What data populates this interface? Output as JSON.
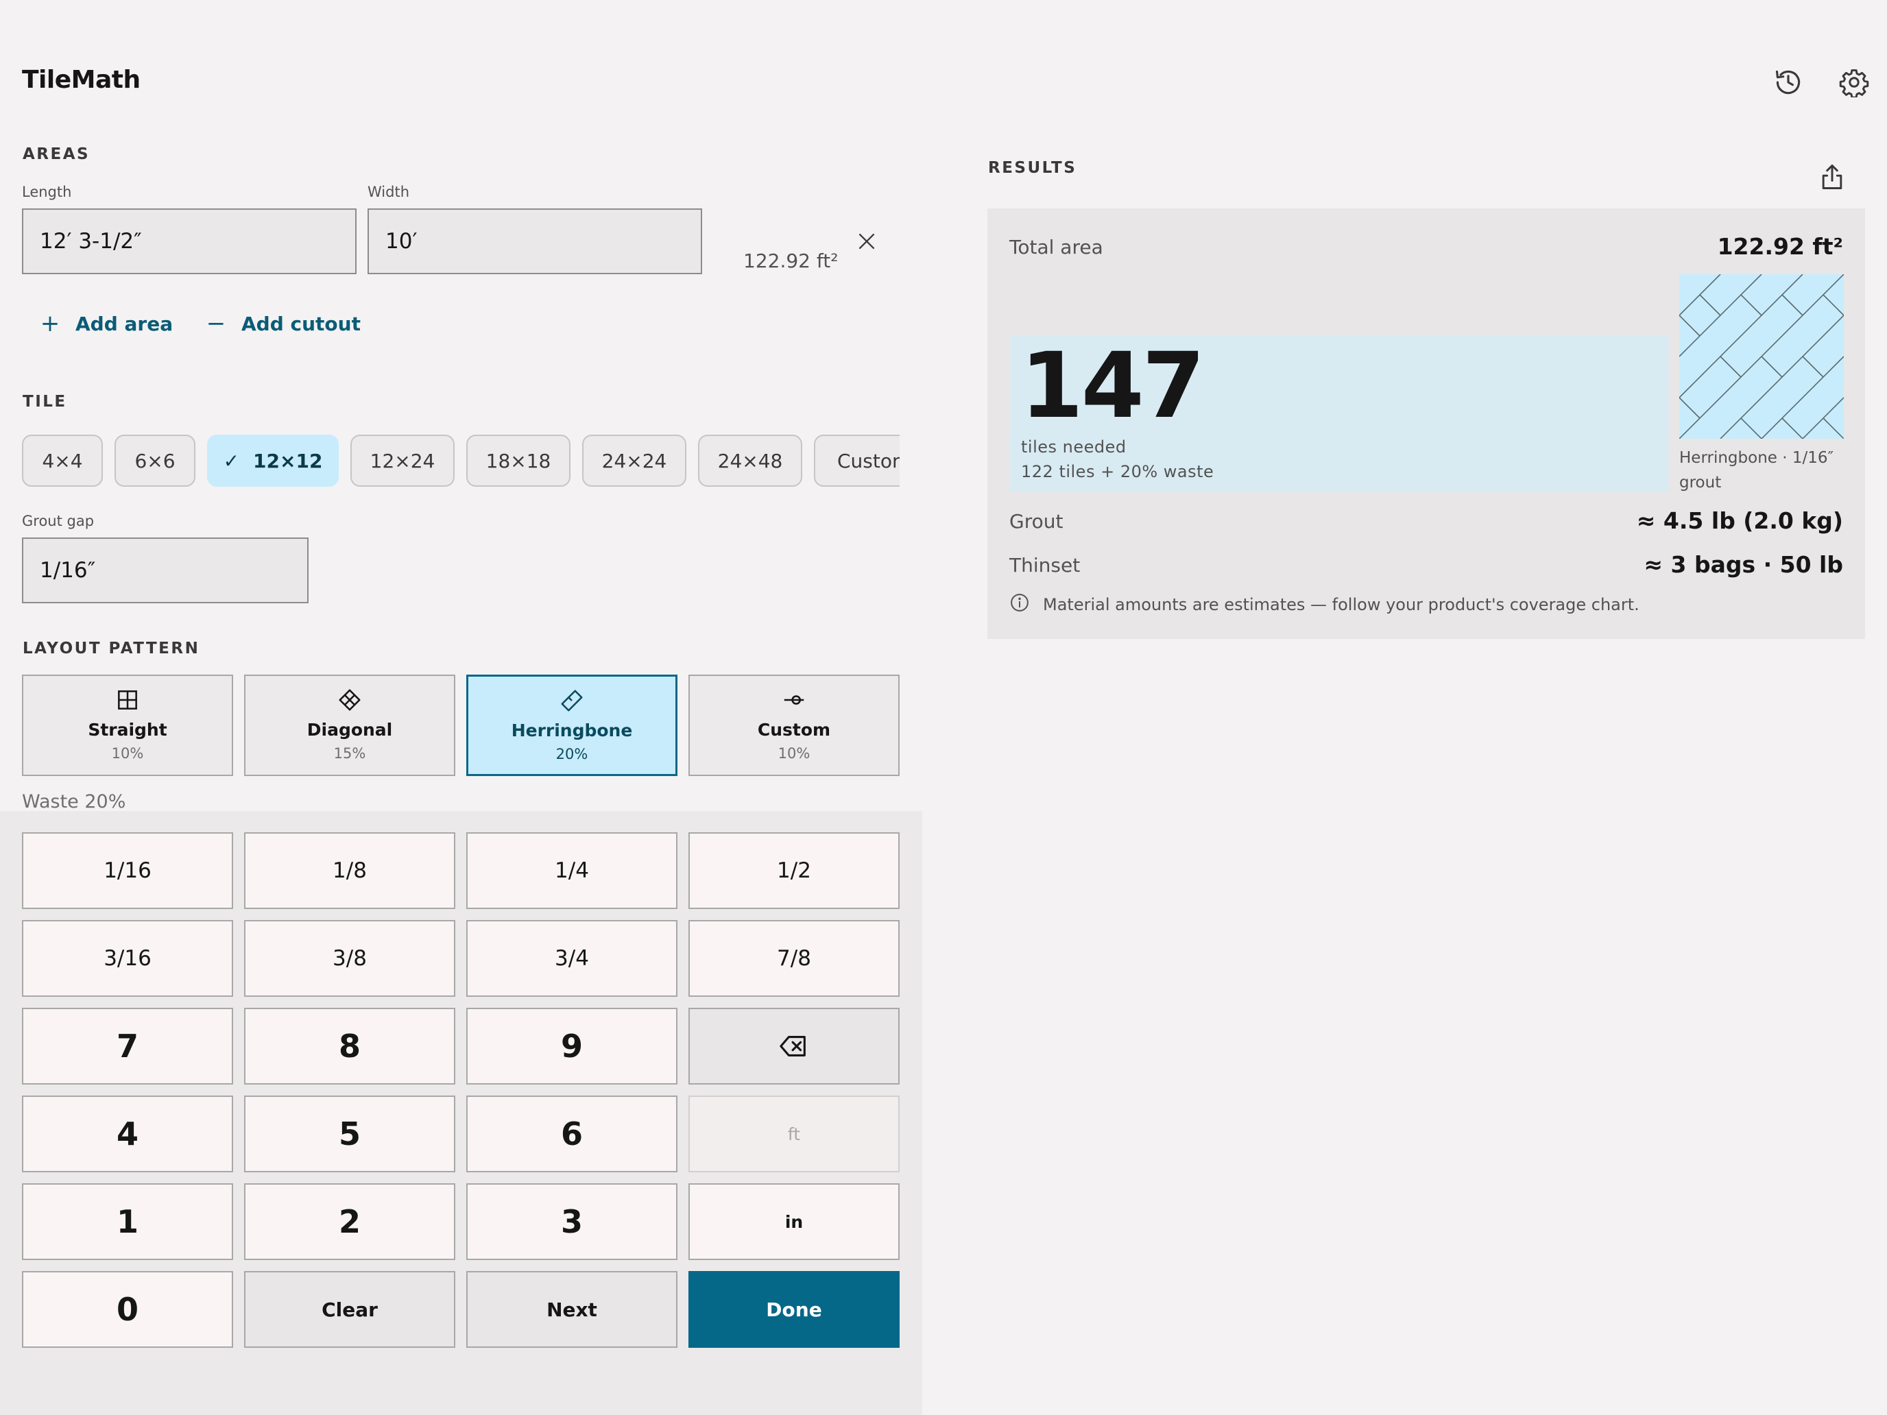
{
  "app": {
    "title": "TileMath"
  },
  "header": {
    "history_icon": "history-icon",
    "settings_icon": "gear-icon"
  },
  "areas": {
    "section_label": "AREAS",
    "length_label": "Length",
    "length_value": "12′ 3-1/2″",
    "width_label": "Width",
    "width_value": "10′",
    "area_result": "122.92 ft²",
    "remove_icon": "close-icon",
    "add_area_label": "Add area",
    "add_cutout_label": "Add cutout"
  },
  "tile": {
    "section_label": "TILE",
    "sizes": [
      {
        "label": "4×4",
        "selected": false
      },
      {
        "label": "6×6",
        "selected": false
      },
      {
        "label": "12×12",
        "selected": true
      },
      {
        "label": "12×24",
        "selected": false
      },
      {
        "label": "18×18",
        "selected": false
      },
      {
        "label": "24×24",
        "selected": false
      },
      {
        "label": "24×48",
        "selected": false
      },
      {
        "label": "Custom",
        "selected": false
      }
    ],
    "grout_gap_label": "Grout gap",
    "grout_gap_value": "1/16″"
  },
  "layout": {
    "section_label": "LAYOUT PATTERN",
    "patterns": [
      {
        "name": "Straight",
        "pct": "10%",
        "icon": "grid-icon",
        "selected": false
      },
      {
        "name": "Diagonal",
        "pct": "15%",
        "icon": "diamond-grid-icon",
        "selected": false
      },
      {
        "name": "Herringbone",
        "pct": "20%",
        "icon": "herringbone-icon",
        "selected": true
      },
      {
        "name": "Custom",
        "pct": "10%",
        "icon": "custom-pattern-icon",
        "selected": false
      }
    ],
    "waste_label": "Waste 20%"
  },
  "keypad": {
    "fractions": [
      "1/16",
      "1/8",
      "1/4",
      "1/2",
      "3/16",
      "3/8",
      "3/4",
      "7/8"
    ],
    "digits": [
      "7",
      "8",
      "9",
      "4",
      "5",
      "6",
      "1",
      "2",
      "3",
      "0"
    ],
    "backspace_icon": "backspace-icon",
    "unit_ft": "ft",
    "unit_in": "in",
    "clear_label": "Clear",
    "next_label": "Next",
    "done_label": "Done"
  },
  "results": {
    "section_label": "RESULTS",
    "share_icon": "share-icon",
    "total_area_label": "Total area",
    "total_area_value": "122.92 ft²",
    "tiles_needed": "147",
    "tiles_needed_label": "tiles needed",
    "tiles_breakdown": "122 tiles + 20% waste",
    "preview_caption": "Herringbone · 1/16″ grout",
    "grout_label": "Grout",
    "grout_value": "≈ 4.5 lb (2.0 kg)",
    "thinset_label": "Thinset",
    "thinset_value": "≈ 3 bags · 50 lb",
    "info_icon": "info-icon",
    "note": "Material amounts are estimates — follow your product's coverage chart."
  },
  "colors": {
    "accent": "#066888",
    "selected_bg": "#c8ecfb",
    "hero_bg": "#d9ebf2",
    "page_bg": "#f4f2f3"
  }
}
